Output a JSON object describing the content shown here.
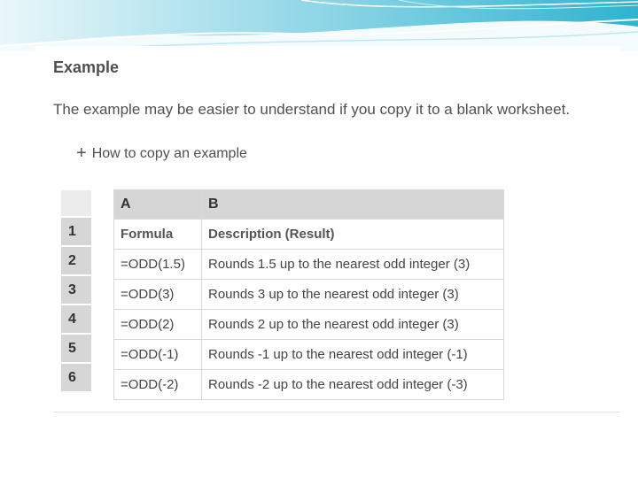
{
  "heading": "Example",
  "intro": "The example may be easier to understand if you copy it to a blank worksheet.",
  "copy_link": {
    "icon": "plus-icon",
    "label": "How to copy an example"
  },
  "sheet": {
    "columns": [
      "A",
      "B"
    ],
    "row_numbers": [
      "1",
      "2",
      "3",
      "4",
      "5",
      "6"
    ],
    "header": {
      "a": "Formula",
      "b": "Description (Result)"
    },
    "rows": [
      {
        "a": "=ODD(1.5)",
        "b": "Rounds 1.5 up to the nearest odd integer (3)"
      },
      {
        "a": "=ODD(3)",
        "b": "Rounds 3 up to the nearest odd integer (3)"
      },
      {
        "a": "=ODD(2)",
        "b": "Rounds 2 up to the nearest odd integer (3)"
      },
      {
        "a": "=ODD(-1)",
        "b": "Rounds -1 up to the nearest odd integer (-1)"
      },
      {
        "a": "=ODD(-2)",
        "b": "Rounds -2 up to the nearest odd integer (-3)"
      }
    ]
  },
  "colors": {
    "banner_teal": "#4fc0d8",
    "banner_light": "#d8f1f6",
    "header_gray": "#d6d6d6"
  }
}
